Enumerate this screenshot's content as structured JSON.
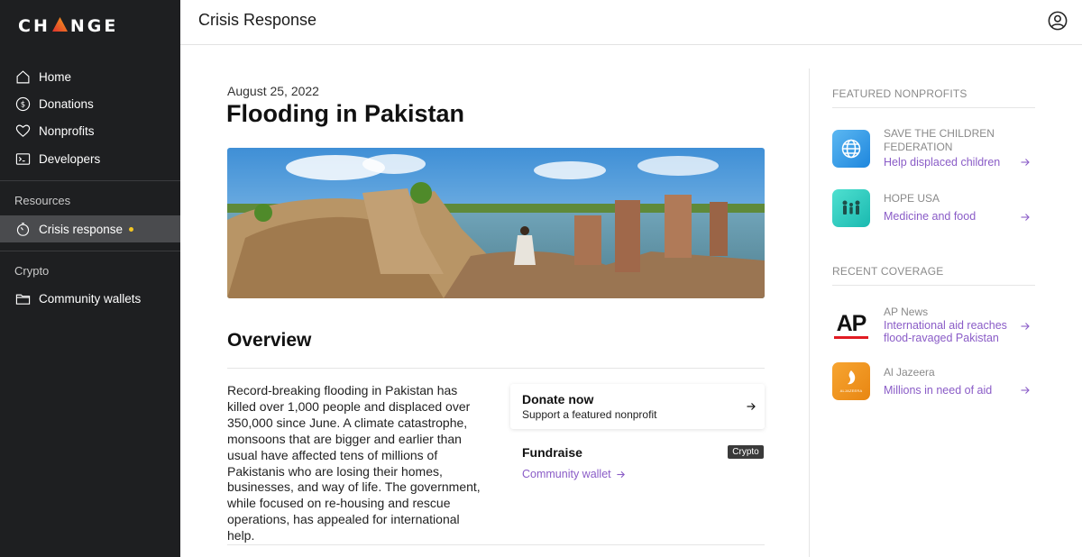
{
  "brand": {
    "logo_text_left": "CH",
    "logo_text_right": "NGE"
  },
  "colors": {
    "sidebar_bg": "#1e1f21",
    "accent_purple": "#8a5cc7",
    "active_dot": "#f3c623"
  },
  "sidebar": {
    "items": [
      {
        "label": "Home",
        "icon": "home-icon"
      },
      {
        "label": "Donations",
        "icon": "dollar-circle-icon"
      },
      {
        "label": "Nonprofits",
        "icon": "heart-icon"
      },
      {
        "label": "Developers",
        "icon": "terminal-icon"
      }
    ],
    "resources_label": "Resources",
    "resources_items": [
      {
        "label": "Crisis response",
        "icon": "timer-icon",
        "active": true
      }
    ],
    "crypto_label": "Crypto",
    "crypto_items": [
      {
        "label": "Community wallets",
        "icon": "folder-icon"
      }
    ]
  },
  "header": {
    "title": "Crisis Response",
    "profile_icon": "user-circle-icon"
  },
  "article": {
    "date": "August 25, 2022",
    "title": "Flooding in Pakistan",
    "overview_heading": "Overview",
    "body": "Record-breaking flooding in Pakistan has killed over 1,000 people and displaced over 350,000 since June. A climate catastrophe, monsoons that are bigger and earlier than usual have affected tens of millions of Pakistanis who are losing their homes, businesses, and way of life. The government, while focused on re-housing and rescue operations, has appealed for international help."
  },
  "donate": {
    "title": "Donate now",
    "subtitle": "Support a featured nonprofit"
  },
  "fundraise": {
    "title": "Fundraise",
    "badge": "Crypto",
    "link": "Community wallet"
  },
  "featured": {
    "heading": "FEATURED NONPROFITS",
    "items": [
      {
        "name": "SAVE THE CHILDREN FEDERATION",
        "link": "Help displaced children",
        "icon": "globe-icon"
      },
      {
        "name": "HOPE USA",
        "link": "Medicine and food",
        "icon": "family-icon"
      }
    ]
  },
  "coverage": {
    "heading": "RECENT COVERAGE",
    "items": [
      {
        "source": "AP News",
        "link": "International aid reaches flood-ravaged Pakistan",
        "logo_text": "AP"
      },
      {
        "source": "Al Jazeera",
        "link": "Millions in need of aid",
        "logo_text": "ALJAZEERA"
      }
    ]
  }
}
